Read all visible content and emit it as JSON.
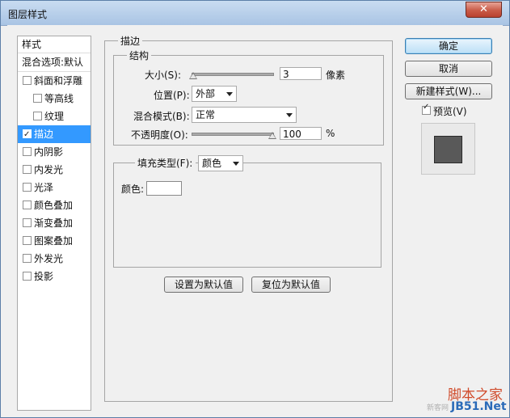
{
  "window": {
    "title": "图层样式",
    "close": "✕"
  },
  "left_panel": {
    "header": "样式",
    "items": [
      {
        "label": "混合选项:默认",
        "checkbox": false,
        "checked": false,
        "sub": false,
        "selected": false
      },
      {
        "label": "斜面和浮雕",
        "checkbox": true,
        "checked": false,
        "sub": false,
        "selected": false
      },
      {
        "label": "等高线",
        "checkbox": true,
        "checked": false,
        "sub": true,
        "selected": false
      },
      {
        "label": "纹理",
        "checkbox": true,
        "checked": false,
        "sub": true,
        "selected": false
      },
      {
        "label": "描边",
        "checkbox": true,
        "checked": true,
        "sub": false,
        "selected": true
      },
      {
        "label": "内阴影",
        "checkbox": true,
        "checked": false,
        "sub": false,
        "selected": false
      },
      {
        "label": "内发光",
        "checkbox": true,
        "checked": false,
        "sub": false,
        "selected": false
      },
      {
        "label": "光泽",
        "checkbox": true,
        "checked": false,
        "sub": false,
        "selected": false
      },
      {
        "label": "颜色叠加",
        "checkbox": true,
        "checked": false,
        "sub": false,
        "selected": false
      },
      {
        "label": "渐变叠加",
        "checkbox": true,
        "checked": false,
        "sub": false,
        "selected": false
      },
      {
        "label": "图案叠加",
        "checkbox": true,
        "checked": false,
        "sub": false,
        "selected": false
      },
      {
        "label": "外发光",
        "checkbox": true,
        "checked": false,
        "sub": false,
        "selected": false
      },
      {
        "label": "投影",
        "checkbox": true,
        "checked": false,
        "sub": false,
        "selected": false
      }
    ]
  },
  "stroke": {
    "title": "描边",
    "structure_title": "结构",
    "size_label": "大小(S):",
    "size_value": "3",
    "size_unit": "像素",
    "size_slider_fraction": 0.02,
    "position_label": "位置(P):",
    "position_value": "外部",
    "blend_label": "混合模式(B):",
    "blend_value": "正常",
    "opacity_label": "不透明度(O):",
    "opacity_value": "100",
    "opacity_unit": "%",
    "opacity_slider_fraction": 1.0,
    "fill_type_label": "填充类型(F):",
    "fill_type_value": "颜色",
    "color_label": "颜色:",
    "color_value": "#ffffff",
    "set_default_button": "设置为默认值",
    "reset_default_button": "复位为默认值"
  },
  "right_panel": {
    "ok_button": "确定",
    "cancel_button": "取消",
    "new_style_button": "新建样式(W)...",
    "preview_label": "预览(V)",
    "preview_checked": true,
    "preview_color": "#595959"
  },
  "watermark": {
    "site": "脚本之家",
    "url": "JB51.Net",
    "small": "新客网"
  },
  "colors": {
    "selection": "#3399ff",
    "default_button": "#bcdff6",
    "watermark": "#d04a2a"
  }
}
